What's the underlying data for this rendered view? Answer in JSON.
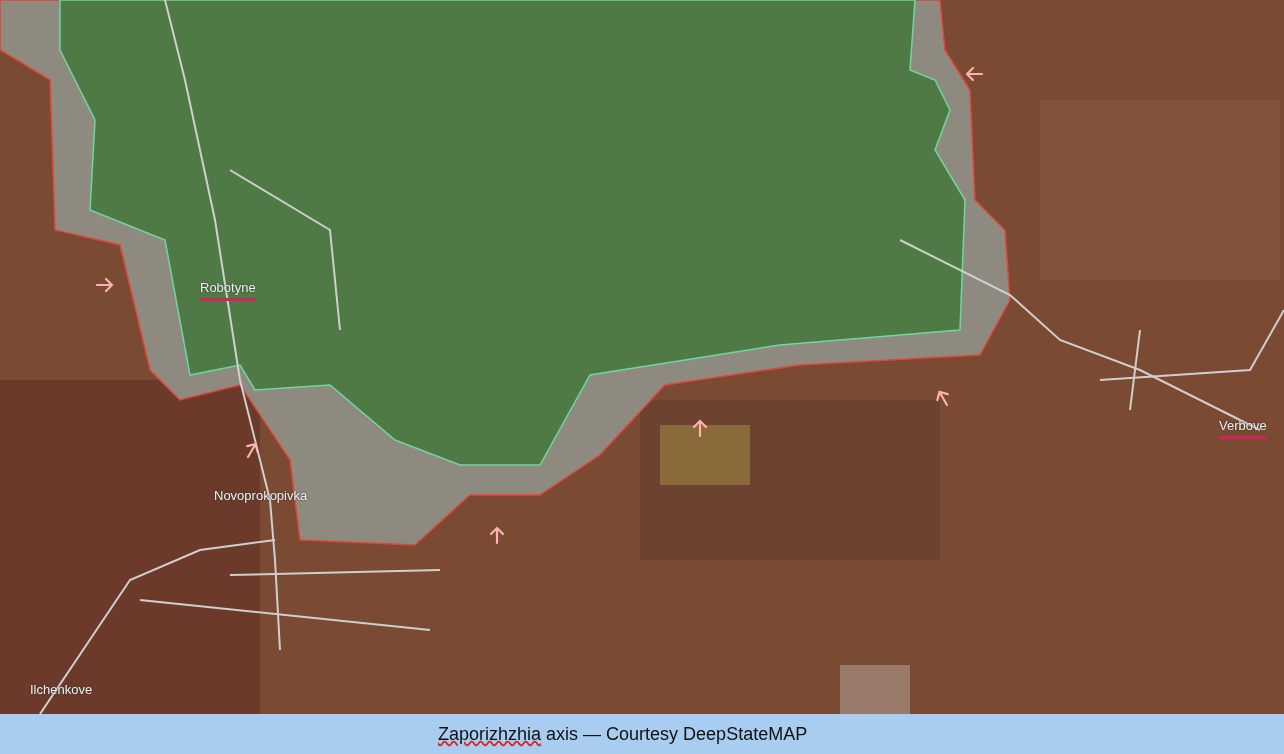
{
  "map": {
    "places": [
      {
        "name": "Robotyne",
        "marked": true
      },
      {
        "name": "Novoprokopivka",
        "marked": false
      },
      {
        "name": "Verbove",
        "marked": true
      },
      {
        "name": "Ilchenkove",
        "marked": false
      }
    ],
    "arrows": [
      {
        "kind": "left"
      },
      {
        "kind": "right"
      },
      {
        "kind": "up-right"
      },
      {
        "kind": "up"
      },
      {
        "kind": "up-left"
      },
      {
        "kind": "up"
      }
    ]
  },
  "caption": {
    "text": "Zaporizhzhia axis — Courtesy DeepStateMAP",
    "first_word_flagged": true
  }
}
